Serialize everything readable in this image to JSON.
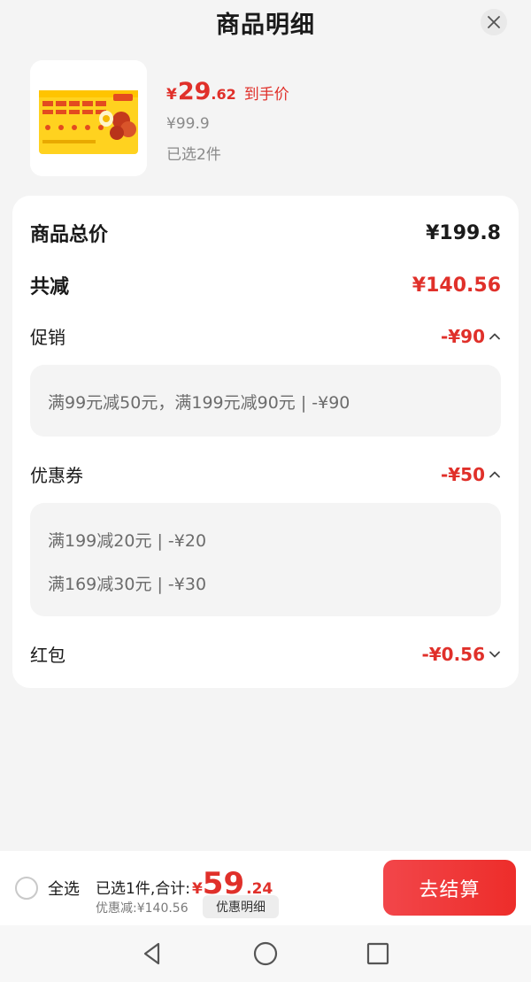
{
  "header": {
    "title": "商品明细"
  },
  "product": {
    "price_symbol": "¥",
    "price_integer": "29",
    "price_decimal": ".62",
    "price_tag": "到手价",
    "original_price": "¥99.9",
    "selected": "已选2件"
  },
  "summary": {
    "total_label": "商品总价",
    "total_value": "¥199.8",
    "reduce_label": "共减",
    "reduce_value": "¥140.56",
    "promo": {
      "label": "促销",
      "value": "-¥90",
      "lines": [
        "满99元减50元，满199元减90元 | -¥90"
      ]
    },
    "coupon": {
      "label": "优惠券",
      "value": "-¥50",
      "lines": [
        "满199减20元 | -¥20",
        "满169减30元 | -¥30"
      ]
    },
    "redpacket": {
      "label": "红包",
      "value": "-¥0.56"
    }
  },
  "bottom": {
    "select_all": "全选",
    "total_label": "已选1件,合计:",
    "total_symbol": "¥",
    "total_integer": "59",
    "total_decimal": ".24",
    "discount": "优惠减:¥140.56",
    "detail_button": "优惠明细",
    "checkout_button": "去结算"
  },
  "colors": {
    "accent": "#e0302a",
    "checkout": "#ed2d2a",
    "background": "#f4f4f4"
  }
}
